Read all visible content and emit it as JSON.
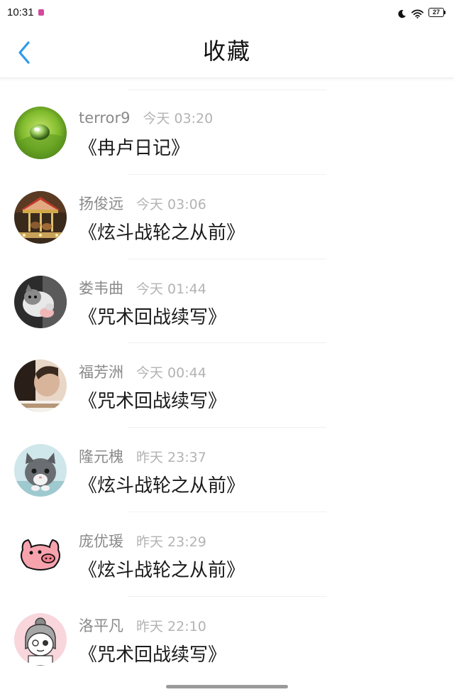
{
  "status_bar": {
    "time": "10:31",
    "battery": "27"
  },
  "header": {
    "title": "收藏"
  },
  "favorites": [
    {
      "username": "terror9",
      "timestamp": "今天 03:20",
      "title": "《冉卢日记》",
      "avatar": "water-drop-leaf"
    },
    {
      "username": "扬俊远",
      "timestamp": "今天 03:06",
      "title": "《炫斗战轮之从前》",
      "avatar": "carousel"
    },
    {
      "username": "娄韦曲",
      "timestamp": "今天 01:44",
      "title": "《咒术回战续写》",
      "avatar": "kitten"
    },
    {
      "username": "福芳洲",
      "timestamp": "今天 00:44",
      "title": "《咒术回战续写》",
      "avatar": "person-photo"
    },
    {
      "username": "隆元槐",
      "timestamp": "昨天 23:37",
      "title": "《炫斗战轮之从前》",
      "avatar": "grey-cat"
    },
    {
      "username": "庞优瑗",
      "timestamp": "昨天 23:29",
      "title": "《炫斗战轮之从前》",
      "avatar": "pig-cartoon"
    },
    {
      "username": "洛平凡",
      "timestamp": "昨天 22:10",
      "title": "《咒术回战续写》",
      "avatar": "girl-cartoon"
    }
  ],
  "colors": {
    "accent": "#2e9bea",
    "username": "#8a8a8a",
    "timestamp": "#b3b3b3",
    "title": "#1a1a1a"
  }
}
